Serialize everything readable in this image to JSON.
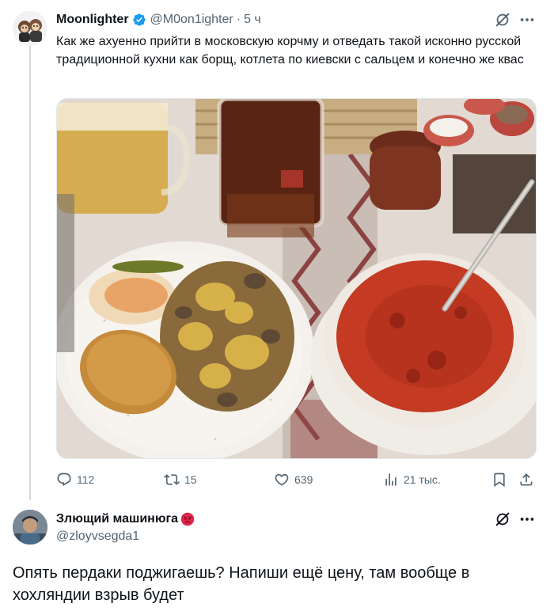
{
  "tweet": {
    "author_name": "Moonlighter",
    "handle": "@M0on1ighter",
    "separator": "·",
    "time": "5 ч",
    "text": "Как же ахуенно прийти в московскую корчму и отведать такой исконно русской традиционной кухни как борщ, котлета по киевски с сальцем и конечно же квас",
    "stats": {
      "replies": "112",
      "retweets": "15",
      "likes": "639",
      "views": "21 тыс."
    }
  },
  "reply": {
    "author_name": "Злющий машинюга",
    "handle": "@zloyvsegda1",
    "text": "Опять пердаки поджигаешь? Напиши ещё цену, там вообще в хохляндии взрыв будет"
  },
  "icons": {
    "verified": "verified-badge-icon",
    "grok": "grok-icon",
    "more": "more-dots-icon",
    "reply": "reply-icon",
    "retweet": "retweet-icon",
    "like": "like-icon",
    "views": "views-icon",
    "bookmark": "bookmark-icon",
    "share": "share-icon",
    "angry_emoji": "angry-face-icon"
  },
  "colors": {
    "text_primary": "#0f1419",
    "text_secondary": "#536471",
    "verified_blue": "#1d9bf0",
    "divider": "#cfd9de"
  }
}
